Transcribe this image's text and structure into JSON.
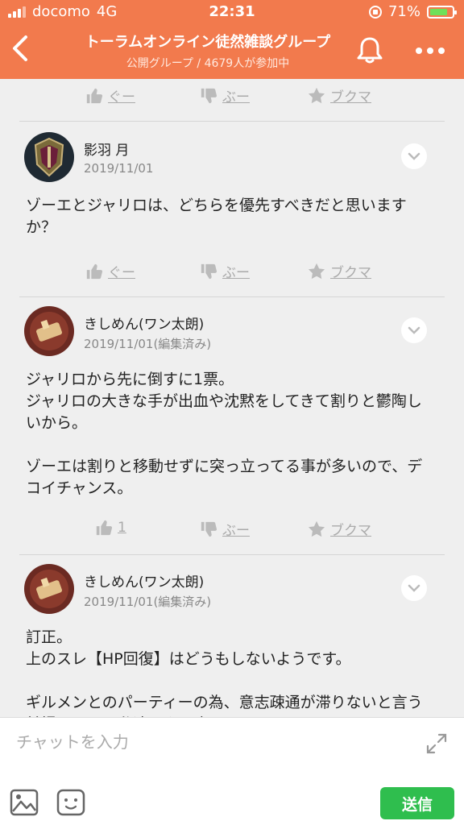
{
  "status": {
    "carrier": "docomo",
    "network": "4G",
    "time": "22:31",
    "battery": "71%"
  },
  "header": {
    "title": "トーラムオンライン徒然雑談グループ",
    "subtitle": "公開グループ / 4679人が参加中"
  },
  "actions_labels": {
    "good": "ぐー",
    "boo": "ぶー",
    "bookmark": "ブクマ"
  },
  "posts": [
    {
      "author": "影羽 月",
      "date": "2019/11/01",
      "body": "ゾーエとジャリロは、どちらを優先すべきだと思いますか？",
      "good": "ぐー"
    },
    {
      "author": "きしめん(ワン太朗)",
      "date": "2019/11/01(編集済み)",
      "body": "ジャリロから先に倒すに1票。\nジャリロの大きな手が出血や沈黙をしてきて割りと鬱陶しいから。\n\nゾーエは割りと移動せずに突っ立ってる事が多いので、デコイチャンス。",
      "good": "1"
    },
    {
      "author": "きしめん(ワン太朗)",
      "date": "2019/11/01(編集済み)",
      "body": "訂正。\n上のスレ【HP回復】はどうもしないようです。\n\nギルメンとのパーティーの為、意志疎通が滞りないと言う前提のうえ、私達のやり方"
    }
  ],
  "input": {
    "placeholder": "チャットを入力",
    "send_label": "送信"
  },
  "colors": {
    "brand": "#f27a4d",
    "send": "#2fbe4e"
  }
}
